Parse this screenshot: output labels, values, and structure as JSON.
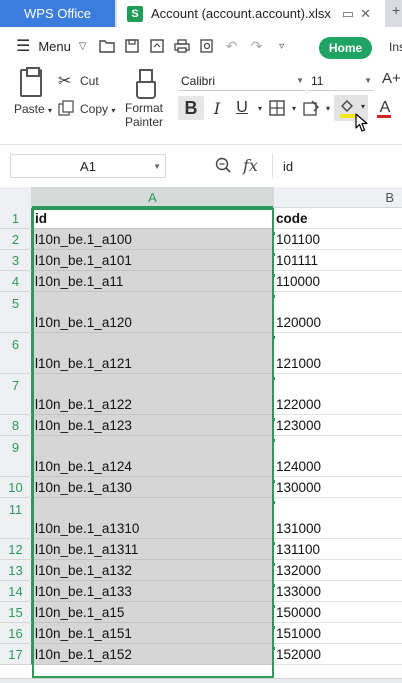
{
  "titlebar": {
    "app_tab": "WPS Office",
    "doc_tab": "Account (account.account).xlsx",
    "doc_icon_letter": "S",
    "more_glyph": "+"
  },
  "menubar": {
    "menu_label": "Menu",
    "home_tab": "Home",
    "insert_tab": "Ins"
  },
  "ribbon": {
    "paste_label": "Paste",
    "cut_label": "Cut",
    "copy_label": "Copy",
    "format_painter_line1": "Format",
    "format_painter_line2": "Painter",
    "font_name": "Calibri",
    "font_size": "11",
    "bold": "B",
    "italic": "I",
    "underline": "U",
    "font_color_letter": "A",
    "grow_font": "A+"
  },
  "formula_bar": {
    "name_box": "A1",
    "fx": "fx",
    "formula_value": "id"
  },
  "grid": {
    "col_a": "A",
    "col_b": "B",
    "header": {
      "num": "1",
      "a": "id",
      "b": "code"
    },
    "rows": [
      {
        "num": "2",
        "a": "l10n_be.1_a100",
        "b": "101100"
      },
      {
        "num": "3",
        "a": "l10n_be.1_a101",
        "b": "101111"
      },
      {
        "num": "4",
        "a": "l10n_be.1_a11",
        "b": "110000"
      },
      {
        "num": "5",
        "a": "l10n_be.1_a120",
        "b": "120000"
      },
      {
        "num": "6",
        "a": "l10n_be.1_a121",
        "b": "121000"
      },
      {
        "num": "7",
        "a": "l10n_be.1_a122",
        "b": "122000"
      },
      {
        "num": "8",
        "a": "l10n_be.1_a123",
        "b": "123000"
      },
      {
        "num": "9",
        "a": "l10n_be.1_a124",
        "b": "124000"
      },
      {
        "num": "10",
        "a": "l10n_be.1_a130",
        "b": "130000"
      },
      {
        "num": "11",
        "a": "l10n_be.1_a1310",
        "b": "131000"
      },
      {
        "num": "12",
        "a": "l10n_be.1_a1311",
        "b": "131100"
      },
      {
        "num": "13",
        "a": "l10n_be.1_a132",
        "b": "132000"
      },
      {
        "num": "14",
        "a": "l10n_be.1_a133",
        "b": "133000"
      },
      {
        "num": "15",
        "a": "l10n_be.1_a15",
        "b": "150000"
      },
      {
        "num": "16",
        "a": "l10n_be.1_a151",
        "b": "151000"
      },
      {
        "num": "17",
        "a": "l10n_be.1_a152",
        "b": "152000"
      }
    ]
  },
  "colors": {
    "accent_green": "#2e9a5a",
    "home_green": "#1fa463",
    "wps_blue": "#3b7ddd",
    "fill_yellow": "#f4e81a",
    "font_red": "#e02020"
  }
}
